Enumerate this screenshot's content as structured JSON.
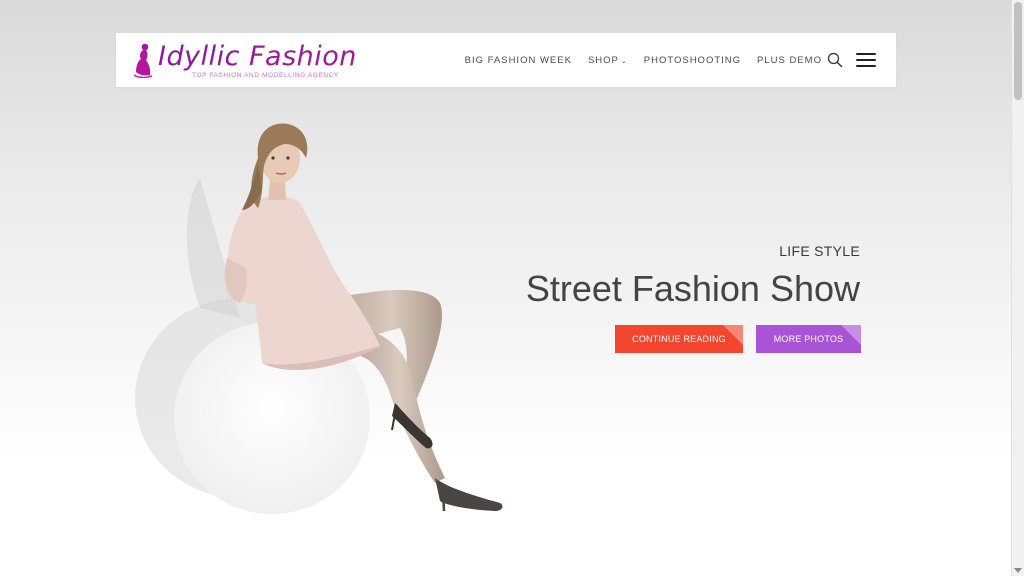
{
  "logo": {
    "name_part1": "Idyllic",
    "name_part2": "Fashion",
    "tagline": "TOP FASHION AND MODELLING AGENCY",
    "brand_color": "#8a1b9e",
    "icon": "woman-silhouette-icon"
  },
  "nav": {
    "items": [
      {
        "label": "BIG FASHION WEEK",
        "has_dropdown": false
      },
      {
        "label": "SHOP",
        "has_dropdown": true
      },
      {
        "label": "PHOTOSHOOTING",
        "has_dropdown": false
      },
      {
        "label": "PLUS DEMO",
        "has_dropdown": false
      }
    ],
    "dropdown_caret": "⌄",
    "search_icon": "search-icon",
    "menu_icon": "hamburger-menu-icon"
  },
  "hero": {
    "subtitle": "LIFE STYLE",
    "title": "Street Fashion Show",
    "buttons": {
      "continue_label": "CONTINUE READING",
      "continue_color": "#f4452f",
      "more_label": "MORE PHOTOS",
      "more_color": "#a954d6"
    }
  }
}
